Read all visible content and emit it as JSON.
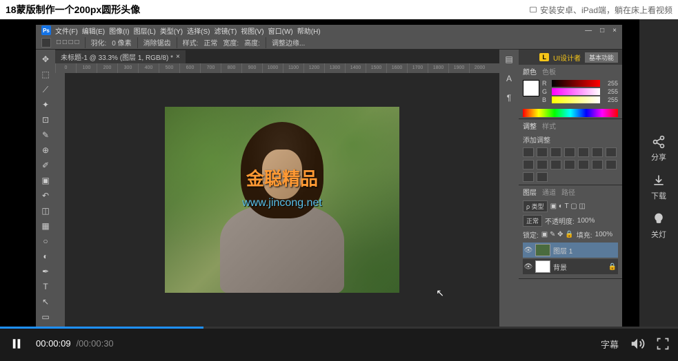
{
  "header": {
    "title": "18蒙版制作一个200px圆形头像",
    "install_link": "安装安卓、iPad端，躺在床上看视频"
  },
  "photoshop": {
    "menu": [
      "文件(F)",
      "编辑(E)",
      "图像(I)",
      "图层(L)",
      "类型(Y)",
      "选择(S)",
      "滤镜(T)",
      "视图(V)",
      "窗口(W)",
      "帮助(H)"
    ],
    "options": {
      "feather_label": "羽化:",
      "feather_value": "0 像素",
      "antialias": "消除锯齿",
      "style_label": "样式:",
      "style_value": "正常",
      "width_label": "宽度:",
      "height_label": "高度:",
      "refine": "调整边缘..."
    },
    "tab": "未标题-1 @ 33.3% (图层 1, RGB/8) *",
    "ruler_marks": [
      "0",
      "100",
      "200",
      "300",
      "400",
      "500",
      "600",
      "700",
      "800",
      "900",
      "1000",
      "1100",
      "1200",
      "1300",
      "1400",
      "1500",
      "1600",
      "1700",
      "1800",
      "1900",
      "2000"
    ],
    "brand": {
      "badge": "L",
      "text": "UI设计者",
      "btn": "基本功能"
    },
    "color_panel": {
      "tabs": [
        "颜色",
        "色板"
      ],
      "r_label": "R",
      "r_val": "255",
      "g_label": "G",
      "g_val": "255",
      "b_label": "B",
      "b_val": "255"
    },
    "adjust_panel": {
      "tabs": [
        "调整",
        "样式"
      ],
      "label": "添加调整"
    },
    "layers_panel": {
      "tabs": [
        "图层",
        "通道",
        "路径"
      ],
      "kind": "ρ 类型",
      "mode": "正常",
      "opacity_label": "不透明度:",
      "opacity_val": "100%",
      "lock_label": "锁定:",
      "fill_label": "填充:",
      "fill_val": "100%",
      "layer1": "图层 1",
      "bg": "背景"
    },
    "watermark": "金聪精品",
    "watermark_url": "www.jincong.net"
  },
  "side_actions": {
    "share": "分享",
    "download": "下载",
    "lights": "关灯"
  },
  "player": {
    "current": "00:00:09",
    "duration": "/00:00:30",
    "subtitle": "字幕"
  }
}
